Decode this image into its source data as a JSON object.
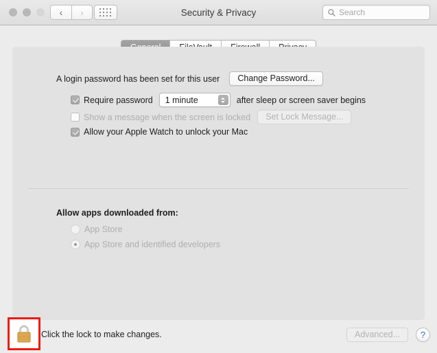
{
  "window": {
    "title": "Security & Privacy",
    "traffic_lights": [
      "close",
      "minimize",
      "zoom"
    ],
    "nav": {
      "back": "back-chevron",
      "forward": "forward-chevron"
    },
    "grid_button": "show-all-icon"
  },
  "search": {
    "placeholder": "Search",
    "icon": "search-icon"
  },
  "tabs": [
    {
      "label": "General",
      "active": true
    },
    {
      "label": "FileVault",
      "active": false
    },
    {
      "label": "Firewall",
      "active": false
    },
    {
      "label": "Privacy",
      "active": false
    }
  ],
  "general": {
    "password_status": "A login password has been set for this user",
    "change_password_button": "Change Password...",
    "require_password": {
      "label": "Require password",
      "checked": true,
      "delay_value": "1 minute",
      "suffix": "after sleep or screen saver begins"
    },
    "lock_message": {
      "label": "Show a message when the screen is locked",
      "checked": false,
      "button": "Set Lock Message..."
    },
    "apple_watch": {
      "label": "Allow your Apple Watch to unlock your Mac",
      "checked": true
    },
    "allow_apps": {
      "title": "Allow apps downloaded from:",
      "options": [
        {
          "label": "App Store",
          "selected": false
        },
        {
          "label": "App Store and identified developers",
          "selected": true
        }
      ]
    }
  },
  "footer": {
    "lock_icon": "closed-padlock-icon",
    "lock_text": "Click the lock to make changes.",
    "advanced_button": "Advanced...",
    "help_button": "?"
  },
  "colors": {
    "window_bg": "#ececec",
    "panel_bg": "#e2e2e2",
    "accent_highlight": "#ee1b11",
    "help_blue": "#2a6fd4",
    "lock_gold": "#e0a84a"
  }
}
